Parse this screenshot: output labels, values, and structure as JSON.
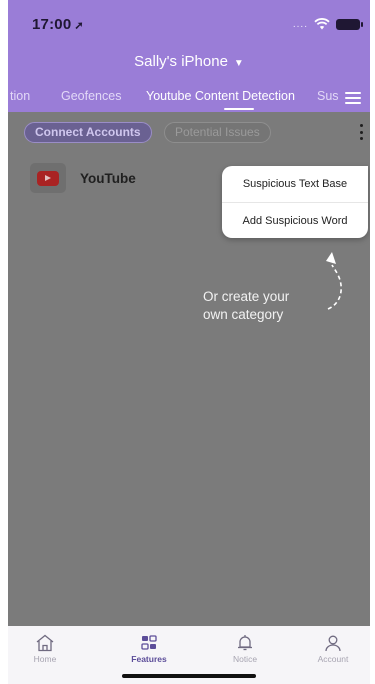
{
  "status_bar": {
    "time": "17:00",
    "location_icon": "location-arrow-icon",
    "signal_dots": "....",
    "wifi_icon": "wifi-icon",
    "battery_icon": "battery-icon"
  },
  "header": {
    "device_name": "Sally's iPhone",
    "device_caret": "▼",
    "background_color": "#9a7dd7"
  },
  "tabs": {
    "items": [
      {
        "label": "tion"
      },
      {
        "label": "Geofences"
      },
      {
        "label": "Youtube Content Detection",
        "active": true
      },
      {
        "label": "Sus"
      }
    ],
    "menu_icon": "hamburger-menu-icon"
  },
  "sub_tabs": {
    "items": [
      {
        "label": "Connect Accounts",
        "active": true
      },
      {
        "label": "Potential Issues"
      }
    ],
    "more_icon": "kebab-menu-icon"
  },
  "accounts": [
    {
      "name": "YouTube",
      "icon": "youtube-icon",
      "brand_color": "#a92323"
    }
  ],
  "dropdown_menu": {
    "items": [
      {
        "label": "Suspicious Text Base"
      },
      {
        "label": "Add Suspicious Word"
      }
    ]
  },
  "hint": {
    "line1": "Or create your",
    "line2": "own category",
    "arrow_icon": "curved-arrow-icon"
  },
  "bottom_nav": {
    "items": [
      {
        "label": "Home",
        "icon": "home-icon"
      },
      {
        "label": "Features",
        "icon": "grid-features-icon",
        "active": true
      },
      {
        "label": "Notice",
        "icon": "bell-icon"
      },
      {
        "label": "Account",
        "icon": "user-icon"
      }
    ],
    "active_color": "#5c4d99"
  }
}
